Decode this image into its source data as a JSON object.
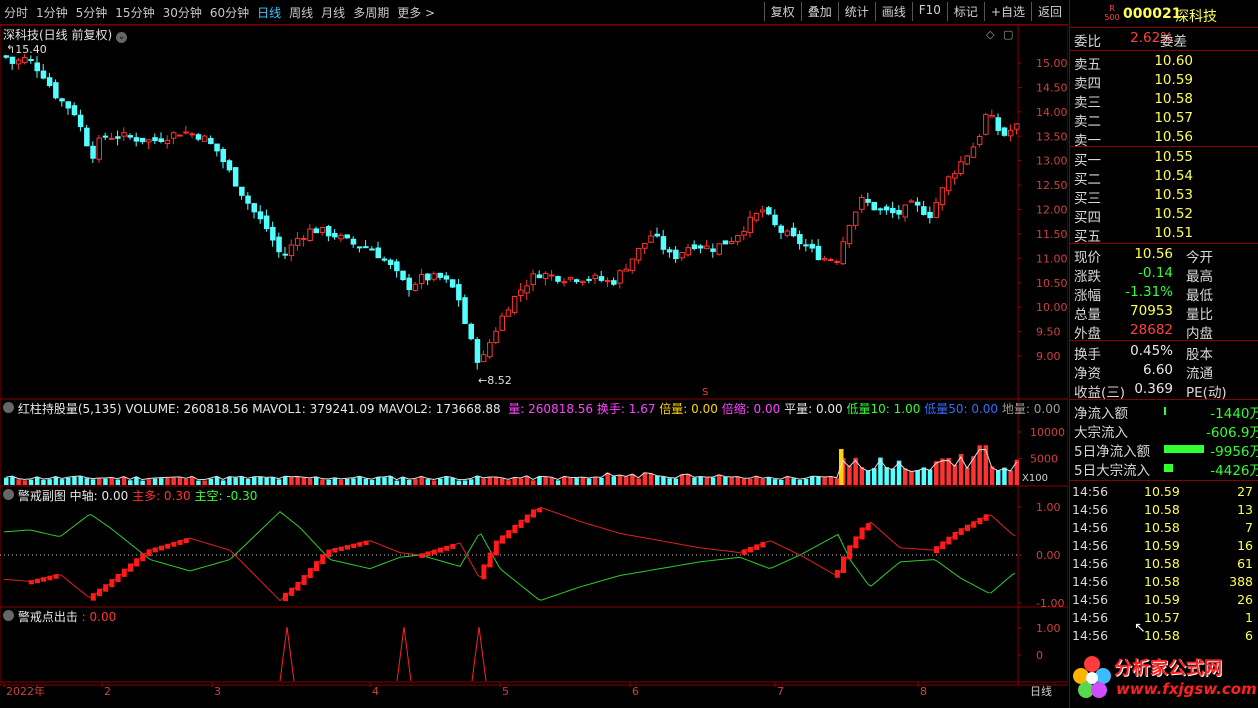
{
  "toolbar": {
    "periods": [
      "分时",
      "1分钟",
      "5分钟",
      "15分钟",
      "30分钟",
      "60分钟",
      "日线",
      "周线",
      "月线",
      "多周期",
      "更多 >"
    ],
    "active_period": "日线",
    "tools": [
      "复权",
      "叠加",
      "统计",
      "画线",
      "F10",
      "标记",
      "+自选",
      "返回"
    ]
  },
  "main_panel": {
    "title": "深科技(日线 前复权)",
    "y_ticks": [
      "15.00",
      "14.50",
      "14.00",
      "13.50",
      "13.00",
      "12.50",
      "12.00",
      "11.50",
      "11.00",
      "10.50",
      "10.00",
      "9.50",
      "9.00"
    ],
    "high_label": "15.40",
    "low_label": "8.52"
  },
  "vol_panel": {
    "name": "红柱持股量(5,135)",
    "volume": "VOLUME: 260818.56",
    "mavol1": "MAVOL1: 379241.09",
    "mavol2": "MAVOL2: 173668.88",
    "liang": "量: 260818.56",
    "huanshou": "换手: 1.67",
    "beiliang": "倍量: 0.00",
    "beisuo": "倍缩: 0.00",
    "pingliang": "平量: 0.00",
    "diliang10": "低量10: 1.00",
    "diliang50": "低量50: 0.00",
    "diliang": "地量: 0.00",
    "y_ticks": [
      "10000",
      "5000"
    ],
    "unit": "X100"
  },
  "sub_panel": {
    "name": "警戒副图",
    "zhongzhou": "中轴: 0.00",
    "zhuduo": "主多: 0.30",
    "zhukong": "主空: -0.30",
    "y_ticks": [
      "1.00",
      "0.00",
      "-1.00"
    ]
  },
  "signal_panel": {
    "name": "警戒点出击",
    "value": ": 0.00",
    "y_ticks": [
      "1.00",
      "0"
    ]
  },
  "x_axis": {
    "labels": [
      "2022年",
      "2",
      "3",
      "4",
      "5",
      "6",
      "7",
      "8"
    ],
    "period": "日线"
  },
  "side": {
    "badge": "R 500",
    "code": "000021",
    "name": "深科技",
    "weibi_label": "委比",
    "weibi": "2.62%",
    "weicha_label": "委差",
    "asks": [
      {
        "label": "卖五",
        "price": "10.60"
      },
      {
        "label": "卖四",
        "price": "10.59"
      },
      {
        "label": "卖三",
        "price": "10.58"
      },
      {
        "label": "卖二",
        "price": "10.57"
      },
      {
        "label": "卖一",
        "price": "10.56"
      }
    ],
    "bids": [
      {
        "label": "买一",
        "price": "10.55"
      },
      {
        "label": "买二",
        "price": "10.54"
      },
      {
        "label": "买三",
        "price": "10.53"
      },
      {
        "label": "买四",
        "price": "10.52"
      },
      {
        "label": "买五",
        "price": "10.51"
      }
    ],
    "quote": [
      {
        "label": "现价",
        "value": "10.56",
        "label2": "今开",
        "color": "#ffff55"
      },
      {
        "label": "涨跌",
        "value": "-0.14",
        "label2": "最高",
        "color": "#32ff32"
      },
      {
        "label": "涨幅",
        "value": "-1.31%",
        "label2": "最低",
        "color": "#32ff32"
      },
      {
        "label": "总量",
        "value": "70953",
        "label2": "量比",
        "color": "#ffff55"
      },
      {
        "label": "外盘",
        "value": "28682",
        "label2": "内盘",
        "color": "#ff4040"
      }
    ],
    "fund": [
      {
        "label": "换手",
        "value": "0.45%",
        "label2": "股本"
      },
      {
        "label": "净资",
        "value": "6.60",
        "label2": "流通"
      },
      {
        "label": "收益(三)",
        "value": "0.369",
        "label2": "PE(动)"
      }
    ],
    "flow": [
      {
        "label": "净流入额",
        "value": "-1440万"
      },
      {
        "label": "大宗流入",
        "value": "-606.9万"
      },
      {
        "label": "5日净流入额",
        "value": "-9956万"
      },
      {
        "label": "5日大宗流入",
        "value": "-4426万"
      }
    ],
    "ticks": [
      {
        "time": "14:56",
        "price": "10.59",
        "vol": "27"
      },
      {
        "time": "14:56",
        "price": "10.58",
        "vol": "13"
      },
      {
        "time": "14:56",
        "price": "10.58",
        "vol": "7"
      },
      {
        "time": "14:56",
        "price": "10.59",
        "vol": "16"
      },
      {
        "time": "14:56",
        "price": "10.58",
        "vol": "61"
      },
      {
        "time": "14:56",
        "price": "10.58",
        "vol": "388"
      },
      {
        "time": "14:56",
        "price": "10.59",
        "vol": "26"
      },
      {
        "time": "14:56",
        "price": "10.57",
        "vol": "1"
      },
      {
        "time": "14:56",
        "price": "10.58",
        "vol": "6"
      }
    ],
    "watermark_cn": "分析家公式网",
    "watermark_url": "www.fxjgsw.com"
  },
  "colors": {
    "up": "#ff3232",
    "down": "#54ffff",
    "border": "#8a0000",
    "accent": "#43c4ff"
  }
}
